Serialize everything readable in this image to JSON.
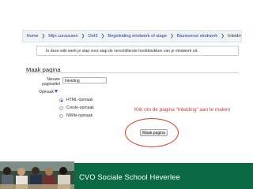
{
  "breadcrumb": {
    "items": [
      "Home",
      "Mijn cursussen",
      "Oef2",
      "Begeleiding eindwerk of stage",
      "Basisverse eindwerk",
      "Inleiding"
    ],
    "separator": "❯"
  },
  "intro_text": "In deze wiki werk je stap voor stap de verschillende hoofdstukken van je eindwerk uit.",
  "form": {
    "legend": "Maak pagina",
    "title_label_line1": "Nieuwe",
    "title_label_line2": "paginatitel",
    "title_value": "Inleiding",
    "format_label": "Opmaak",
    "options": [
      "HTML-opmaak",
      "Creole-opmaak",
      "NWiki-opmaak"
    ],
    "selected_option": "HTML-opmaak",
    "submit_label": "Maak pagina"
  },
  "instruction": "Klik om de pagina “Inleiding” aan te maken",
  "footer": {
    "school_name": "CVO Sociale School Heverlee"
  },
  "colors": {
    "link": "#1f3d8a",
    "accent_red": "#d83a2b",
    "footer_green": "#0b6a42"
  }
}
